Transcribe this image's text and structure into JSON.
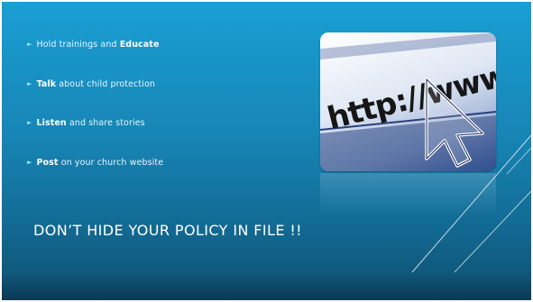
{
  "slide": {
    "bullets": [
      {
        "before": "Hold trainings and ",
        "bold": "Educate",
        "after": ""
      },
      {
        "before": "",
        "bold": "Talk",
        "after": " about child protection"
      },
      {
        "before": "",
        "bold": "Listen",
        "after": " and share stories"
      },
      {
        "before": "",
        "bold": "Post",
        "after": " on your church website"
      }
    ],
    "title": "DON’T HIDE YOUR POLICY IN  FILE !!",
    "image": {
      "text": "http://www",
      "icon": "mouse-cursor-icon"
    }
  }
}
